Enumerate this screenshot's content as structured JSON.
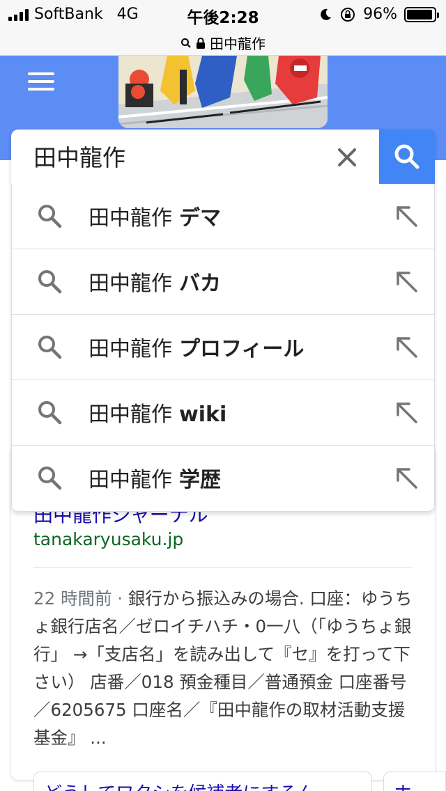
{
  "status_bar": {
    "carrier": "SoftBank",
    "network": "4G",
    "time": "午後2:28",
    "battery_text": "96%",
    "battery_level": 0.96
  },
  "url_bar": {
    "domain": "田中龍作"
  },
  "search": {
    "query": "田中龍作"
  },
  "suggestions": [
    {
      "prefix": "田中龍作",
      "suffix": "デマ"
    },
    {
      "prefix": "田中龍作",
      "suffix": "バカ"
    },
    {
      "prefix": "田中龍作",
      "suffix": "プロフィール"
    },
    {
      "prefix": "田中龍作",
      "suffix": "wiki"
    },
    {
      "prefix": "田中龍作",
      "suffix": "学歴"
    }
  ],
  "result": {
    "title": "田中龍作ジャーナル",
    "url": "tanakaryusaku.jp",
    "date": "22 時間前 · ",
    "snippet": "銀行から振込みの場合. 口座：ゆうちょ銀行店名／ゼロイチハチ・0一八（「ゆうちょ銀行」 →「支店名」を読み出して『セ』を打って下さい） 店番／018 預金種目／普通預金 口座番号／6205675 口座名／『田中龍作の取材活動支援基金』 ...",
    "related_1": "どうしてワタシを候補者にするん",
    "related_2": "ホ"
  },
  "colors": {
    "header_blue": "#5c8df5",
    "search_button": "#4285f4",
    "link": "#1a0dab",
    "url_green": "#0b6623"
  }
}
